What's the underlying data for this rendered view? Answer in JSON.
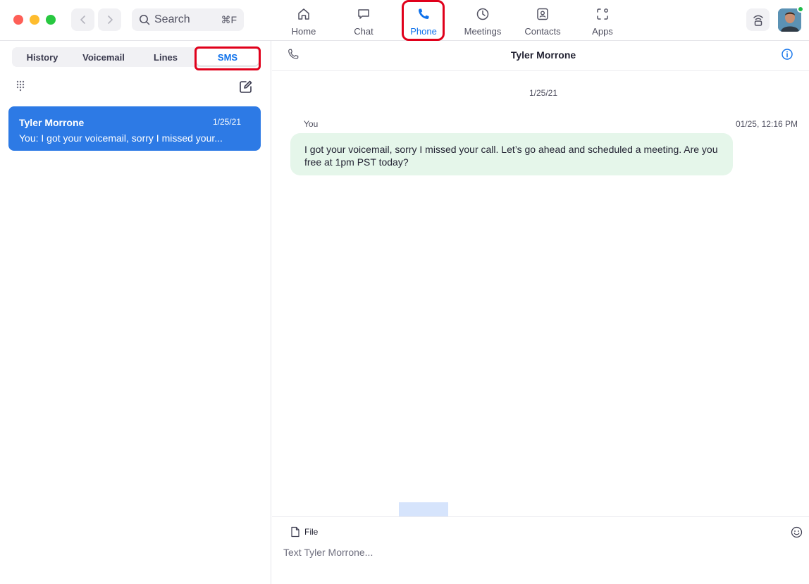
{
  "toolbar": {
    "search_label": "Search",
    "search_shortcut": "⌘F",
    "tabs": [
      {
        "label": "Home",
        "icon": "home-icon"
      },
      {
        "label": "Chat",
        "icon": "chat-icon"
      },
      {
        "label": "Phone",
        "icon": "phone-icon",
        "active": true
      },
      {
        "label": "Meetings",
        "icon": "clock-icon"
      },
      {
        "label": "Contacts",
        "icon": "contacts-icon"
      },
      {
        "label": "Apps",
        "icon": "apps-icon"
      }
    ],
    "accent_color": "#0e71eb",
    "highlight_color": "#e0001b"
  },
  "phone": {
    "tabs": [
      {
        "label": "History"
      },
      {
        "label": "Voicemail"
      },
      {
        "label": "Lines"
      },
      {
        "label": "SMS",
        "active": true
      }
    ],
    "conversations": [
      {
        "name": "Tyler Morrone",
        "date": "1/25/21",
        "preview": "You: I got your voicemail, sorry I missed your..."
      }
    ]
  },
  "chat": {
    "contact_name": "Tyler Morrone",
    "date_separator": "1/25/21",
    "message": {
      "sender": "You",
      "timestamp": "01/25, 12:16 PM",
      "text": "I got your voicemail, sorry I missed your call. Let’s go ahead and scheduled a meeting. Are you free at 1pm PST today?"
    },
    "composer": {
      "file_label": "File",
      "placeholder": "Text Tyler Morrone..."
    }
  }
}
